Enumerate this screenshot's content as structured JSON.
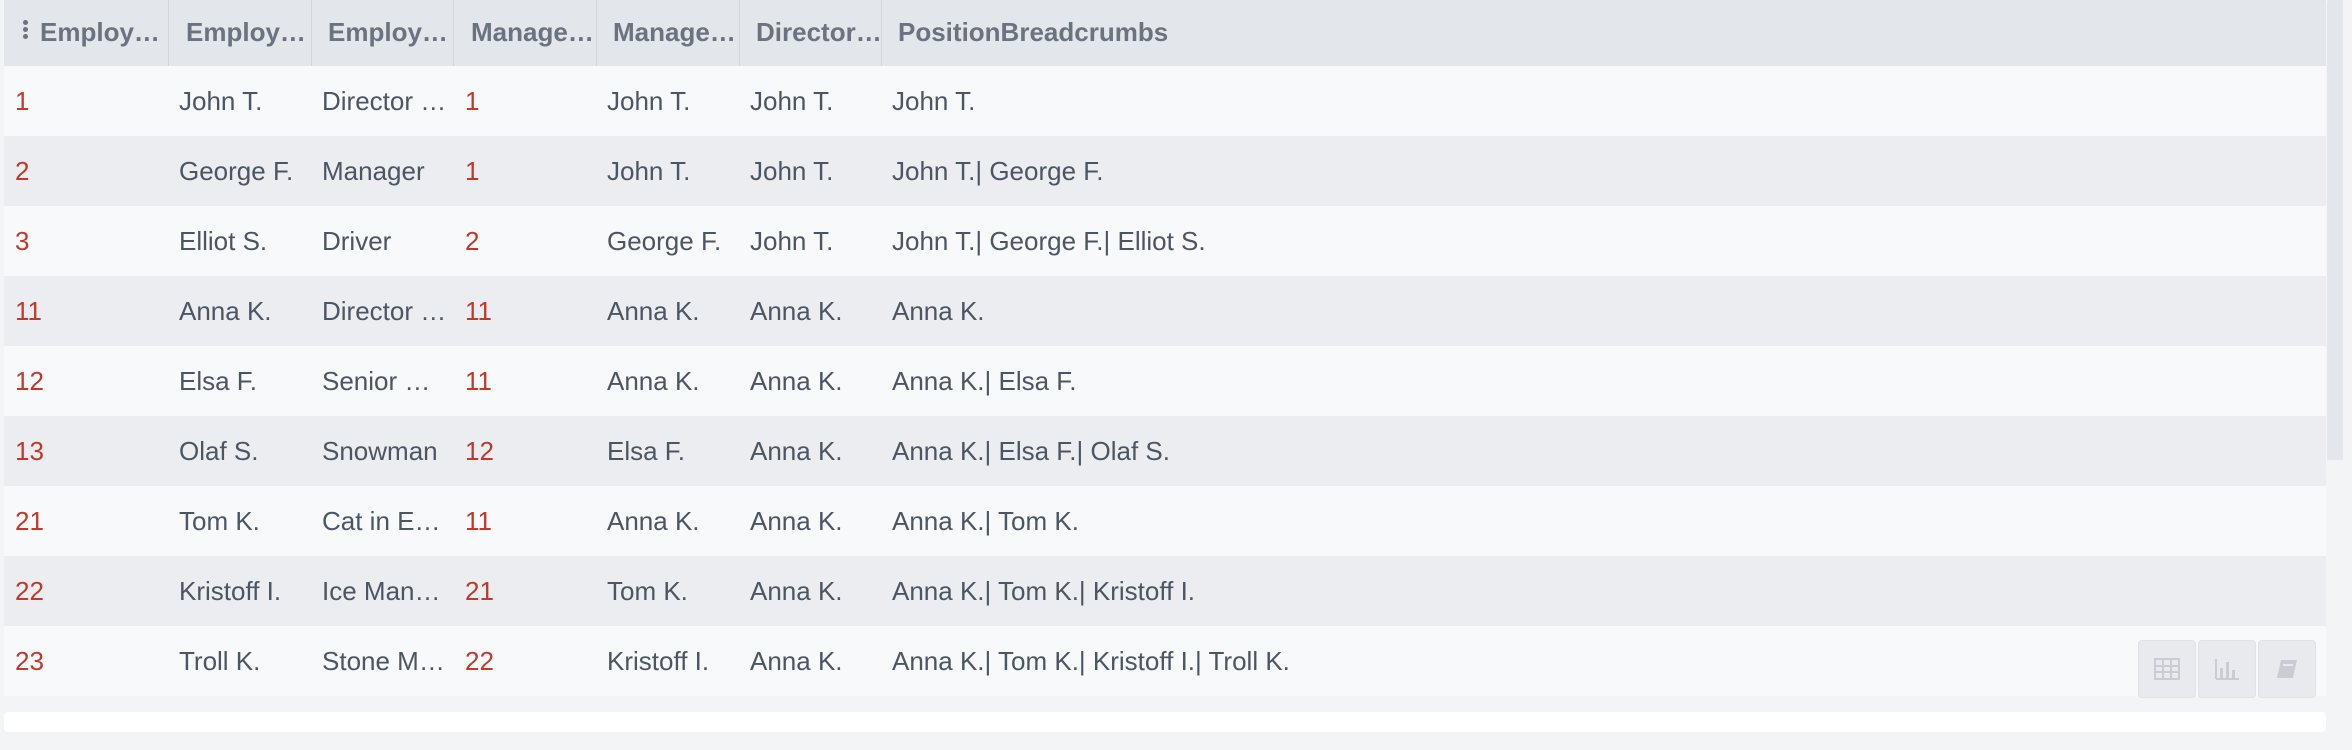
{
  "grid": {
    "columns": [
      {
        "key": "EmployeeId",
        "label": "EmployeeId"
      },
      {
        "key": "EmployeeName",
        "label": "EmployeeN…"
      },
      {
        "key": "EmployeeTitle",
        "label": "EmployeeTi…"
      },
      {
        "key": "ManagerId",
        "label": "ManagerId"
      },
      {
        "key": "ManagerName",
        "label": "ManagerNa…"
      },
      {
        "key": "DirectorName",
        "label": "DirectorName"
      },
      {
        "key": "PositionBreadcrumbs",
        "label": "PositionBreadcrumbs"
      }
    ],
    "rows": [
      [
        "1",
        "John T.",
        "Director of A…",
        "1",
        "John T.",
        "John T.",
        "John T."
      ],
      [
        "2",
        "George F.",
        "Manager",
        "1",
        "John T.",
        "John T.",
        "John T.| George F."
      ],
      [
        "3",
        "Elliot S.",
        "Driver",
        "2",
        "George F.",
        "John T.",
        "John T.| George F.| Elliot S."
      ],
      [
        "11",
        "Anna K.",
        "Director of E…",
        "11",
        "Anna K.",
        "Anna K.",
        "Anna K."
      ],
      [
        "12",
        "Elsa F.",
        "Senior Mana…",
        "11",
        "Anna K.",
        "Anna K.",
        "Anna K.| Elsa F."
      ],
      [
        "13",
        "Olaf S.",
        "Snowman",
        "12",
        "Elsa F.",
        "Anna K.",
        "Anna K.| Elsa F.| Olaf S."
      ],
      [
        "21",
        "Tom K.",
        "Cat in Europ…",
        "11",
        "Anna K.",
        "Anna K.",
        "Anna K.| Tom K."
      ],
      [
        "22",
        "Kristoff I.",
        "Ice Manager",
        "21",
        "Tom K.",
        "Anna K.",
        "Anna K.| Tom K.| Kristoff I."
      ],
      [
        "23",
        "Troll K.",
        "Stone Manager",
        "22",
        "Kristoff I.",
        "Anna K.",
        "Anna K.| Tom K.| Kristoff I.| Troll K."
      ]
    ]
  },
  "toolbar": {
    "buttons": [
      {
        "name": "table-view-button",
        "icon": "table-icon"
      },
      {
        "name": "chart-view-button",
        "icon": "bar-chart-icon"
      },
      {
        "name": "notebook-view-button",
        "icon": "book-icon"
      }
    ]
  },
  "colors": {
    "numeric_text": "#c0392b",
    "text": "#4b5563",
    "header_bg": "#e3e6ea"
  }
}
